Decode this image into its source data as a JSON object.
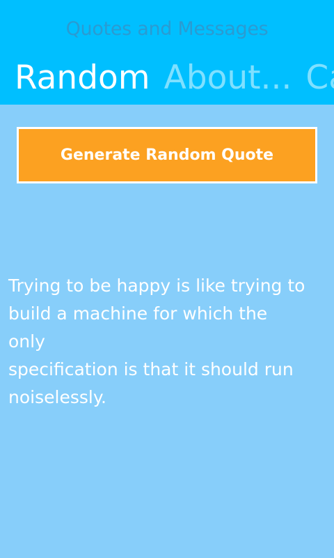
{
  "app": {
    "title": "Quotes and Messages"
  },
  "pivot": {
    "items": [
      {
        "label": "Random",
        "active": true
      },
      {
        "label": "About...",
        "active": false
      },
      {
        "label": "Cat",
        "active": false
      }
    ]
  },
  "main": {
    "generate_button_label": "Generate Random Quote",
    "quote_lines": [
      "Trying to be happy is like trying to",
      "build a machine for which the",
      "only",
      "specification is that it should run",
      "noiselessly."
    ]
  },
  "colors": {
    "header_bg": "#00bfff",
    "page_bg": "#87cefa",
    "button_bg": "#fca121",
    "text": "#ffffff"
  }
}
